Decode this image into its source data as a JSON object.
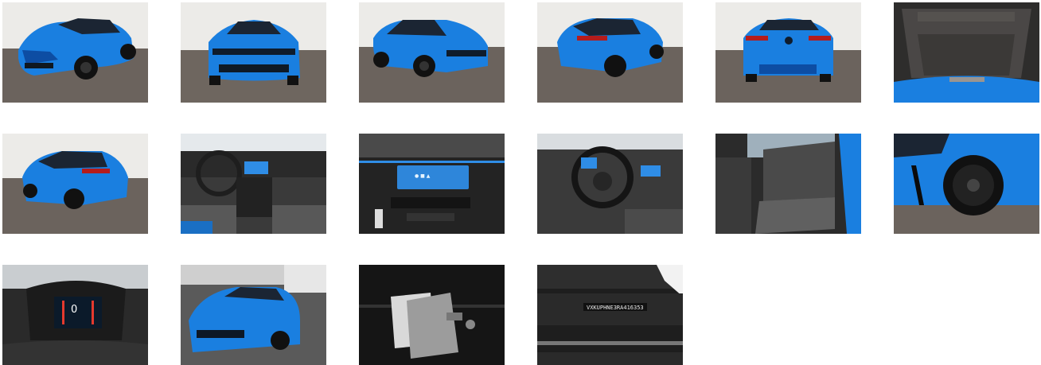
{
  "gallery": {
    "thumbnails": [
      {
        "id": "front-left",
        "subject": "exterior-front-three-quarter-left"
      },
      {
        "id": "front",
        "subject": "exterior-front"
      },
      {
        "id": "front-right",
        "subject": "exterior-front-three-quarter-right"
      },
      {
        "id": "rear-left",
        "subject": "exterior-rear-three-quarter"
      },
      {
        "id": "rear",
        "subject": "exterior-rear"
      },
      {
        "id": "trunk",
        "subject": "trunk-interior"
      },
      {
        "id": "rear-left-2",
        "subject": "exterior-rear-three-quarter-left"
      },
      {
        "id": "dashboard",
        "subject": "interior-dashboard"
      },
      {
        "id": "infotainment",
        "subject": "infotainment-screen"
      },
      {
        "id": "steering-wheel",
        "subject": "steering-wheel"
      },
      {
        "id": "rear-seats",
        "subject": "rear-seats"
      },
      {
        "id": "wheel",
        "subject": "wheel-closeup"
      },
      {
        "id": "instrument-cluster",
        "subject": "instrument-cluster"
      },
      {
        "id": "showroom",
        "subject": "showroom-front"
      },
      {
        "id": "documents",
        "subject": "documents-and-keys"
      },
      {
        "id": "vin-plate",
        "subject": "vin-plate"
      }
    ],
    "cluster_reading": "0",
    "vin_text": "VXKUPHNE3RA416353",
    "colors": {
      "car_blue": "#1a7fe0",
      "car_dark": "#0d4da3",
      "studio_floor": "#6a625c",
      "studio_wall": "#ececea"
    }
  }
}
